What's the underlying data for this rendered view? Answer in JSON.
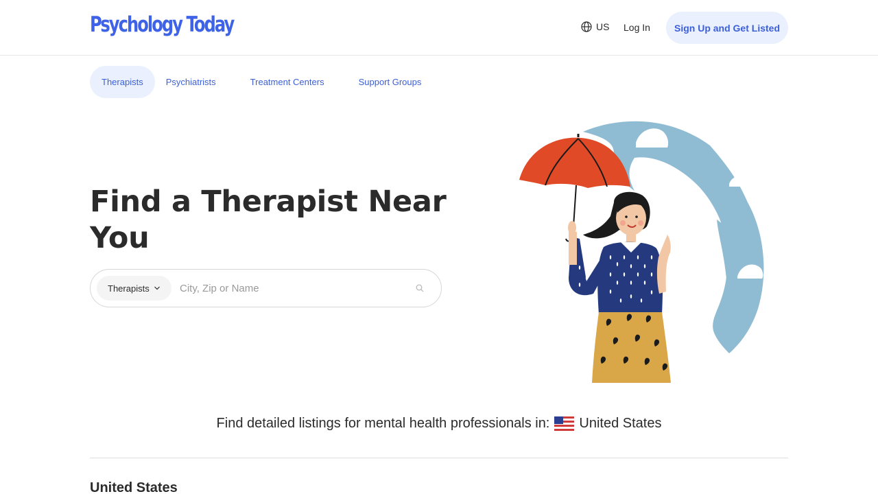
{
  "header": {
    "logo": "Psychology Today",
    "region_label": "US",
    "login_label": "Log In",
    "signup_label": "Sign Up and Get Listed"
  },
  "tabs": [
    {
      "label": "Therapists",
      "active": true
    },
    {
      "label": "Psychiatrists",
      "active": false
    },
    {
      "label": "Treatment Centers",
      "active": false
    },
    {
      "label": "Support Groups",
      "active": false
    }
  ],
  "hero": {
    "title": "Find a Therapist Near You"
  },
  "search": {
    "type_label": "Therapists",
    "placeholder": "City, Zip or Name",
    "value": ""
  },
  "listing": {
    "prefix": "Find detailed listings for mental health professionals in:",
    "country": "United States"
  },
  "section": {
    "title": "United States"
  },
  "icons": {
    "region": "globe-icon",
    "dropdown": "chevron-down-icon",
    "search": "search-icon",
    "flag": "us-flag-icon"
  },
  "colors": {
    "brand": "#3f63e6",
    "link": "#3b5fd9",
    "pill_bg": "#eaf0fd",
    "text": "#2b2b2b"
  }
}
